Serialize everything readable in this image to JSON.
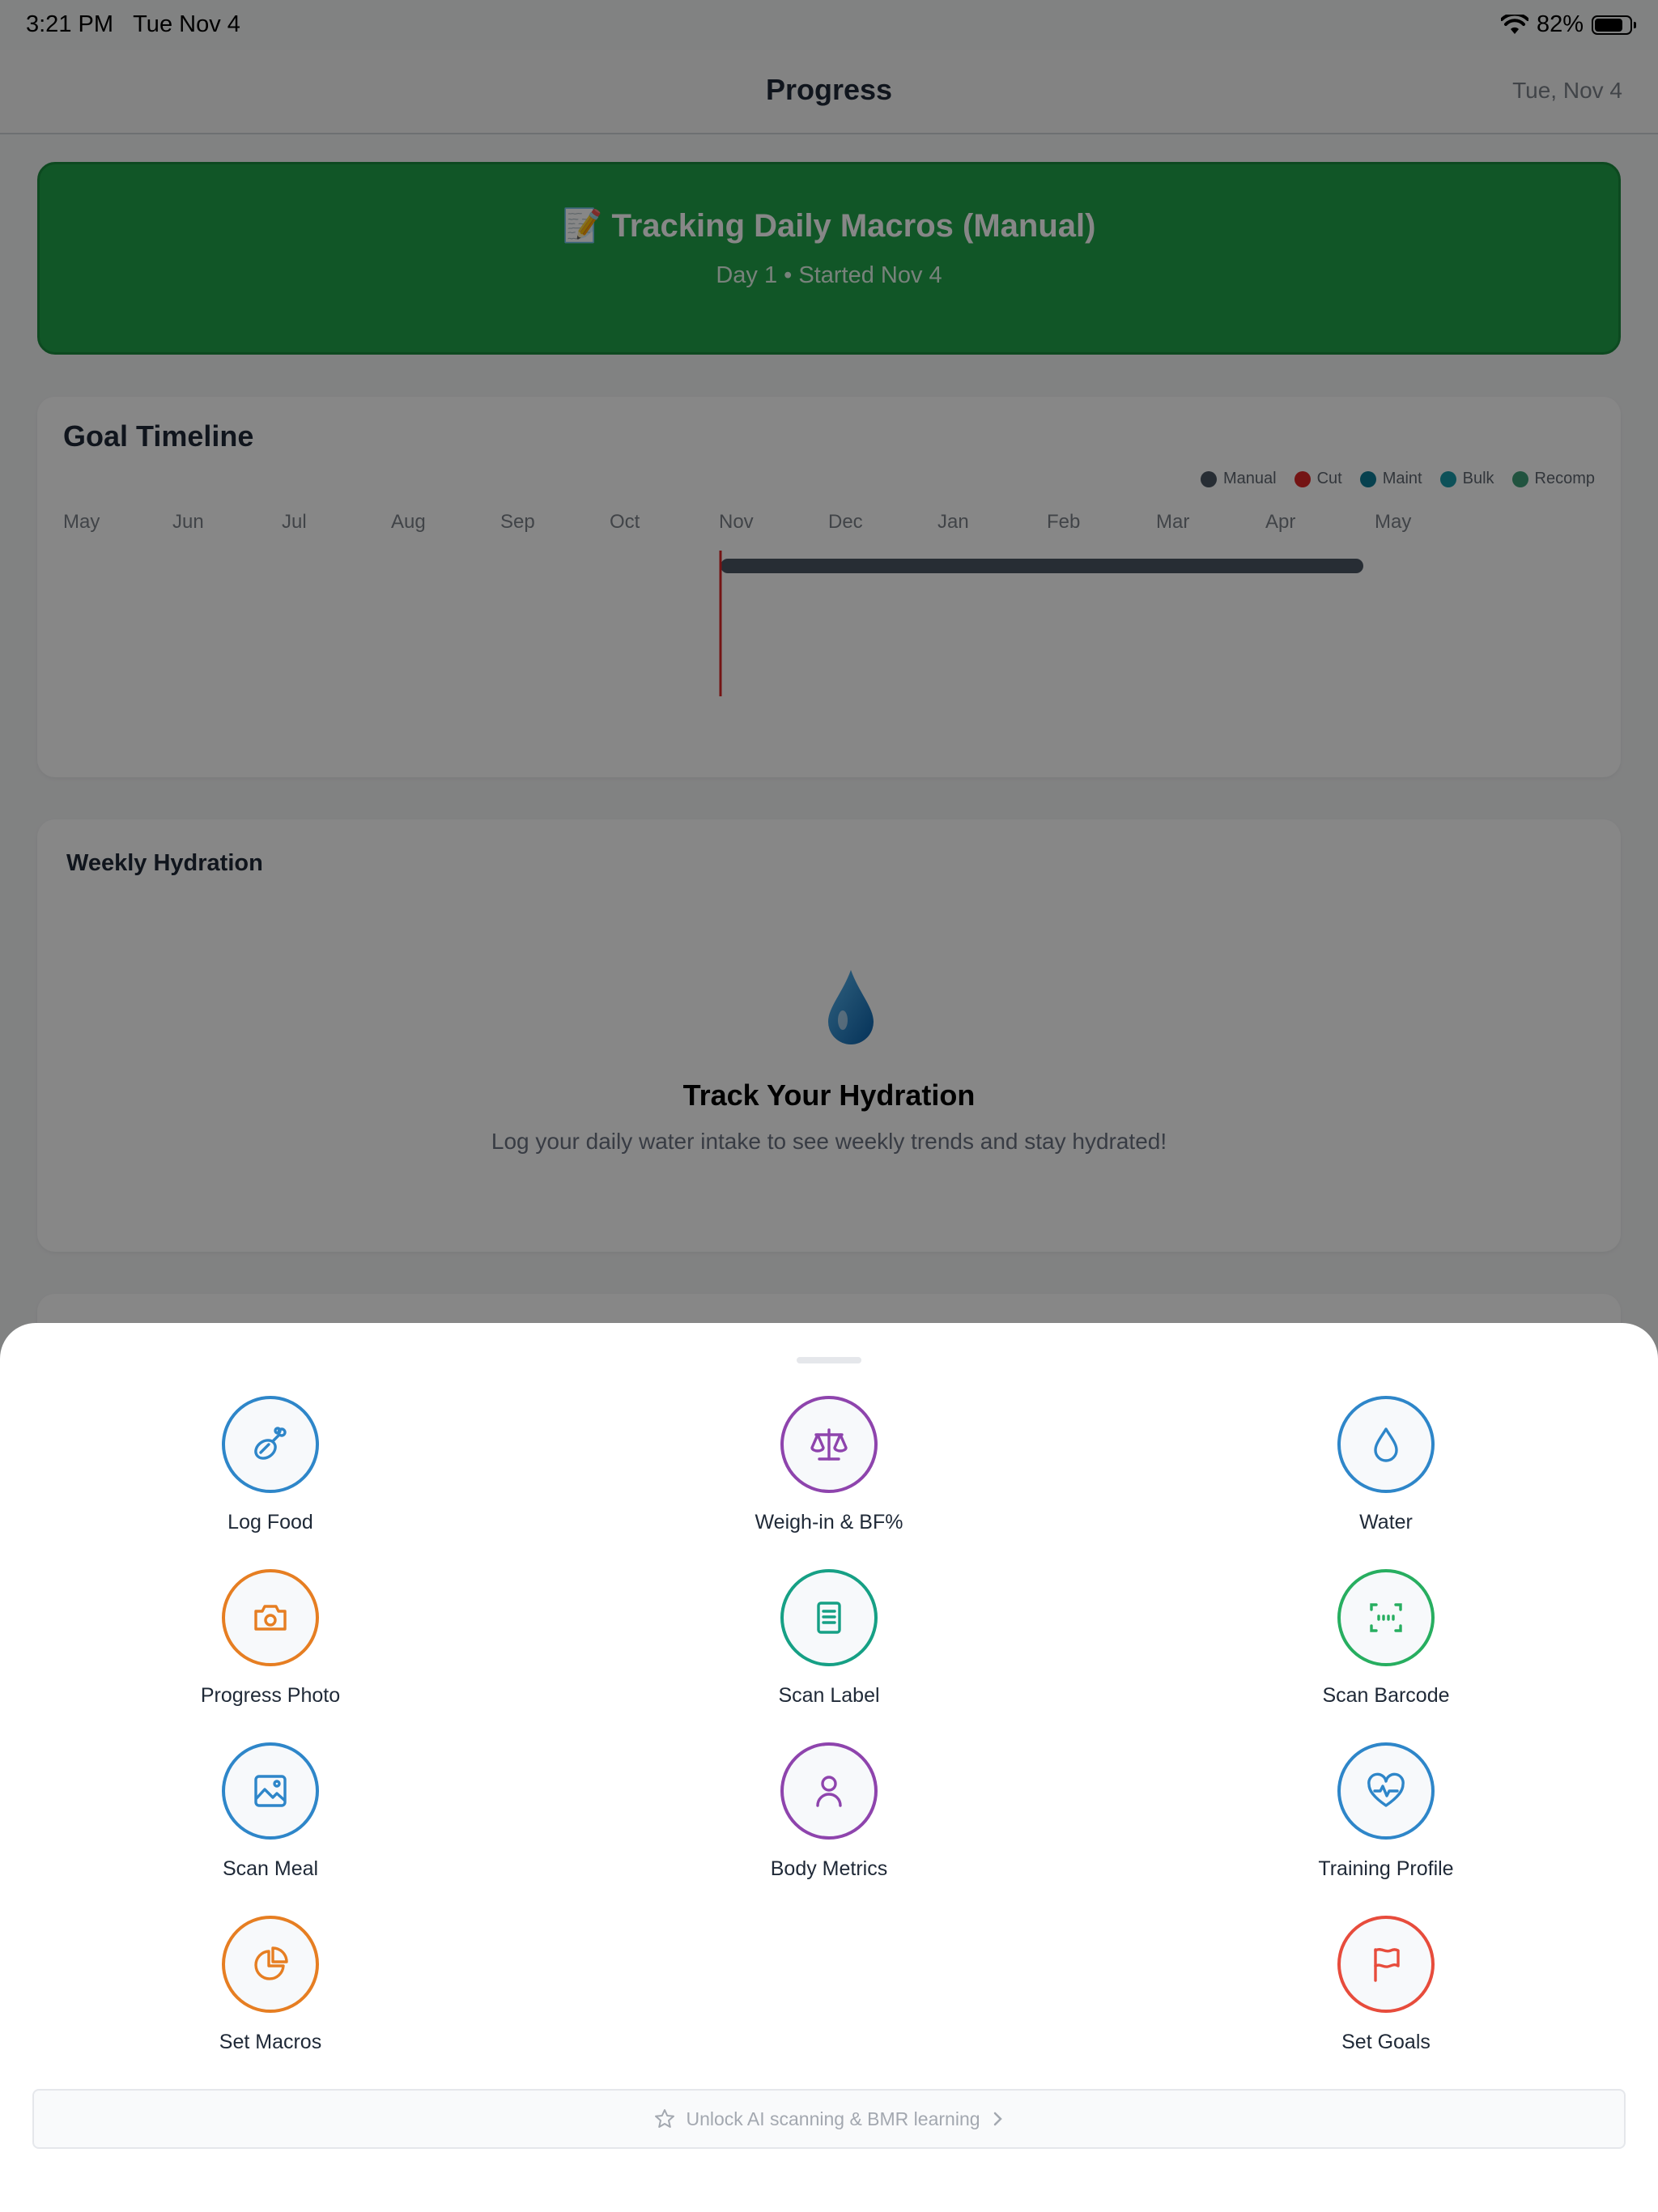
{
  "status_bar": {
    "time": "3:21 PM",
    "date": "Tue Nov 4",
    "battery": "82%",
    "battery_level": 0.82
  },
  "nav": {
    "title": "Progress",
    "date": "Tue, Nov 4"
  },
  "banner": {
    "emoji": "📝",
    "title": "Tracking Daily Macros (Manual)",
    "subtitle": "Day 1 • Started Nov 4",
    "color": "#21a24a"
  },
  "timeline": {
    "title": "Goal Timeline",
    "legend": [
      {
        "label": "Manual",
        "color": "#4b5563"
      },
      {
        "label": "Cut",
        "color": "#dc2626"
      },
      {
        "label": "Maint",
        "color": "#0e7c95"
      },
      {
        "label": "Bulk",
        "color": "#1a9aa8"
      },
      {
        "label": "Recomp",
        "color": "#3f9e77"
      }
    ],
    "months": [
      "May",
      "Jun",
      "Jul",
      "Aug",
      "Sep",
      "Oct",
      "Nov",
      "Dec",
      "Jan",
      "Feb",
      "Mar",
      "Apr",
      "May"
    ],
    "current_month": "Nov",
    "goal_bar": {
      "mode": "Manual",
      "start": "Nov",
      "end": "May"
    }
  },
  "hydration": {
    "title": "Weekly Hydration",
    "heading": "Track Your Hydration",
    "text": "Log your daily water intake to see weekly trends and stay hydrated!"
  },
  "sheet": {
    "actions": [
      {
        "label": "Log Food",
        "icon": "food-icon",
        "color": "#2e86c9"
      },
      {
        "label": "Weigh-in & BF%",
        "icon": "scale-icon",
        "color": "#8e44ad"
      },
      {
        "label": "Water",
        "icon": "water-drop-icon",
        "color": "#2e86c9"
      },
      {
        "label": "Progress Photo",
        "icon": "camera-icon",
        "color": "#e67e22"
      },
      {
        "label": "Scan Label",
        "icon": "document-icon",
        "color": "#16a085"
      },
      {
        "label": "Scan Barcode",
        "icon": "barcode-scan-icon",
        "color": "#27ae60"
      },
      {
        "label": "Scan Meal",
        "icon": "image-icon",
        "color": "#2e86c9"
      },
      {
        "label": "Body Metrics",
        "icon": "person-icon",
        "color": "#8e44ad"
      },
      {
        "label": "Training Profile",
        "icon": "heart-pulse-icon",
        "color": "#2e86c9"
      },
      {
        "label": "Set Macros",
        "icon": "pie-chart-icon",
        "color": "#e67e22"
      },
      {
        "label": "Set Goals",
        "icon": "flag-icon",
        "color": "#e74c3c"
      }
    ],
    "upgrade": {
      "label": "Unlock AI scanning & BMR learning",
      "icon": "star-icon"
    }
  }
}
